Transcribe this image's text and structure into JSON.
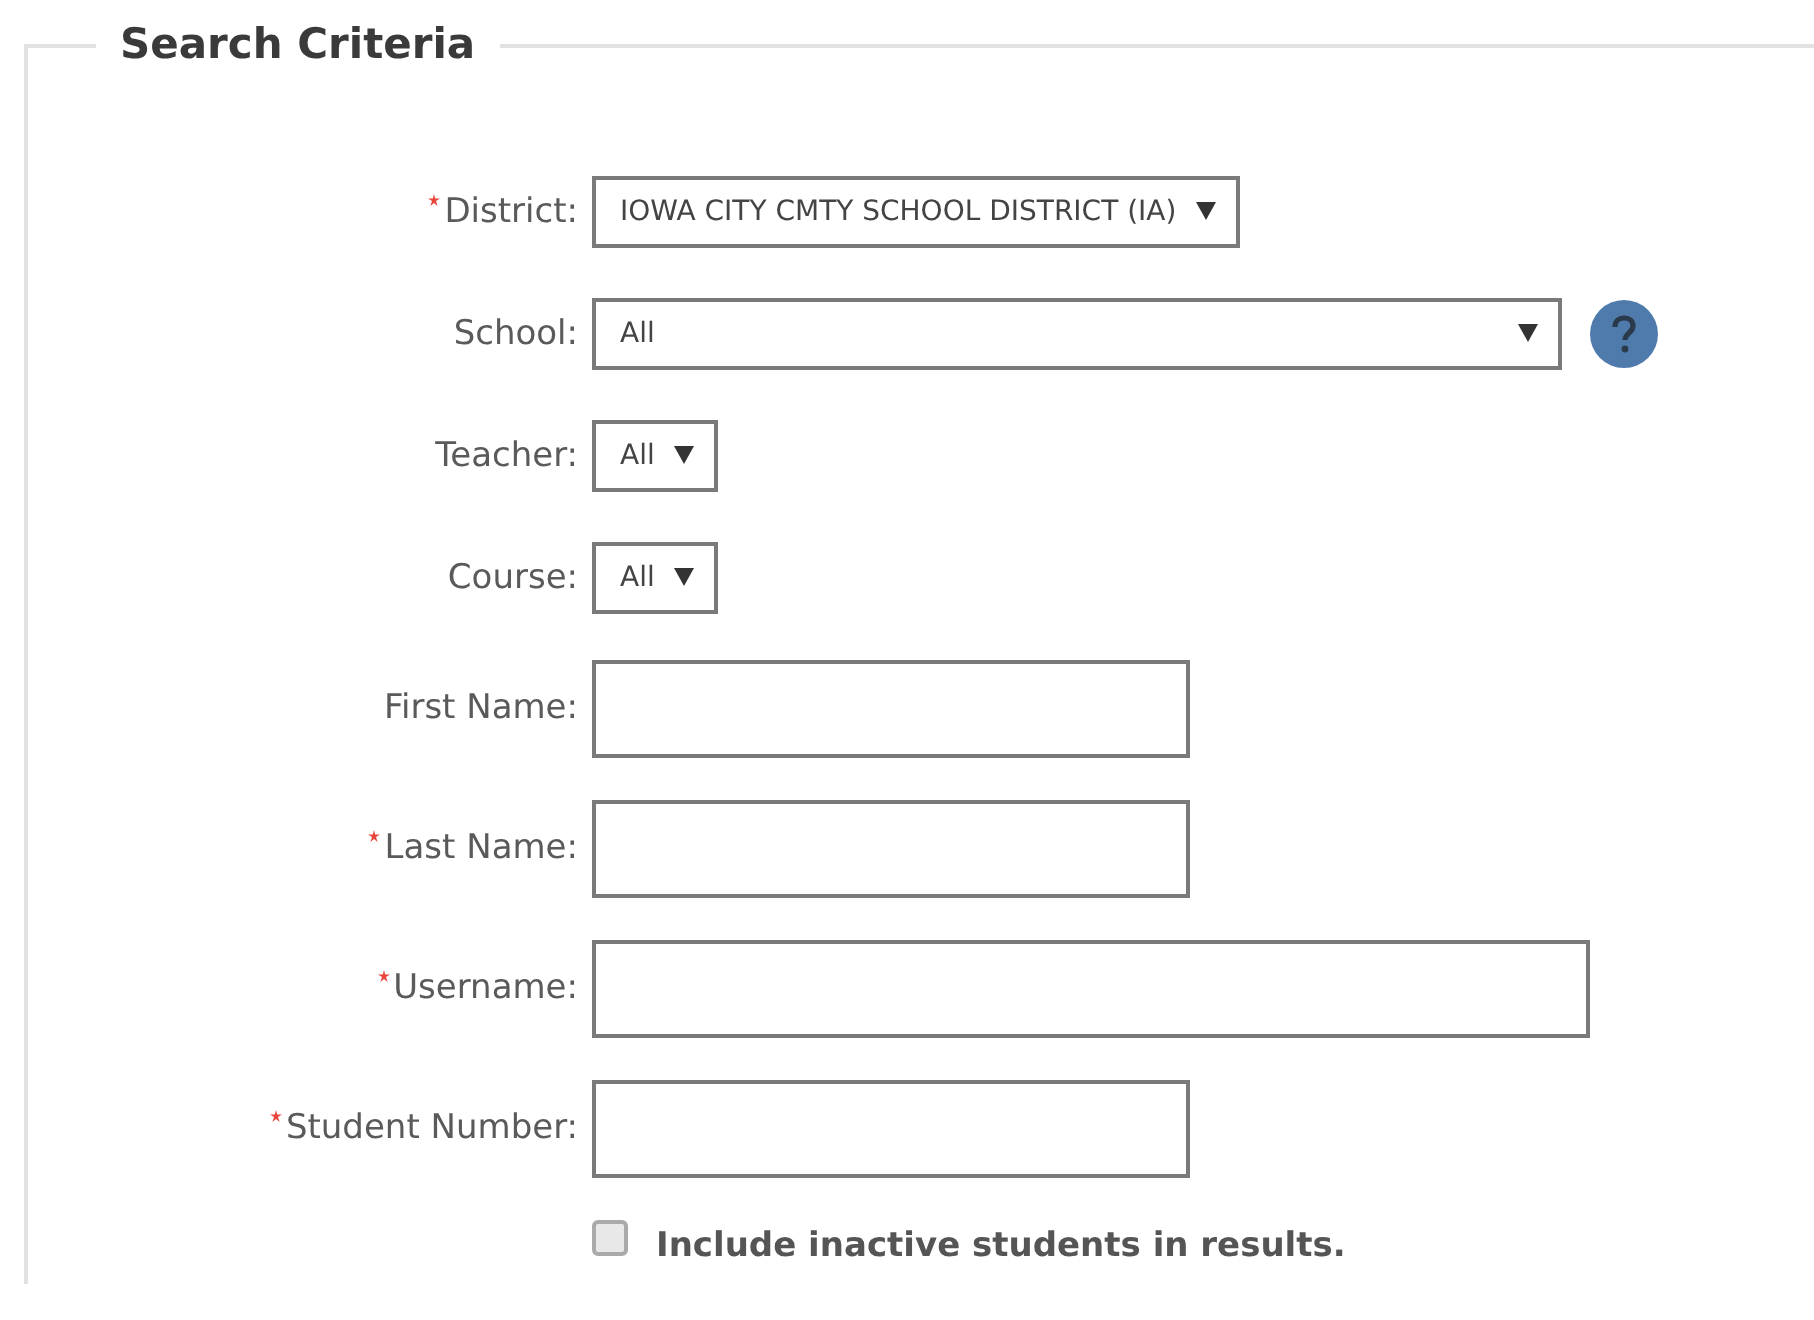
{
  "search_criteria": {
    "title": "Search Criteria",
    "fields": [
      {
        "kind": "select",
        "label": "District:",
        "required": true,
        "value": "IOWA CITY CMTY SCHOOL DISTRICT (IA)"
      },
      {
        "kind": "select",
        "label": "School:",
        "required": false,
        "value": "All",
        "help": true
      },
      {
        "kind": "select",
        "label": "Teacher:",
        "required": false,
        "value": "All"
      },
      {
        "kind": "select",
        "label": "Course:",
        "required": false,
        "value": "All"
      },
      {
        "kind": "text",
        "label": "First Name:",
        "required": false
      },
      {
        "kind": "text",
        "label": "Last Name:",
        "required": true
      },
      {
        "kind": "text",
        "label": "Username:",
        "required": true
      },
      {
        "kind": "text",
        "label": "Student Number:",
        "required": true
      }
    ],
    "checkbox": {
      "label": "Include inactive students in results.",
      "checked": false
    }
  }
}
